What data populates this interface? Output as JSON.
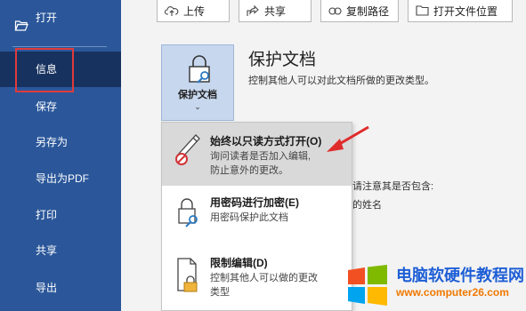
{
  "sidebar": {
    "items": [
      {
        "label": "打开"
      },
      {
        "label": "信息"
      },
      {
        "label": "保存"
      },
      {
        "label": "另存为"
      },
      {
        "label": "导出为PDF"
      },
      {
        "label": "打印"
      },
      {
        "label": "共享"
      },
      {
        "label": "导出"
      }
    ]
  },
  "toolbar": {
    "upload": "上传",
    "share": "共享",
    "copy_path": "复制路径",
    "open_location": "打开文件位置"
  },
  "protect": {
    "tile_label": "保护文档",
    "chevron": "⌄",
    "title": "保护文档",
    "description": "控制其他人可以对此文档所做的更改类型。"
  },
  "background": {
    "partial_line1": "请注意其是否包含:",
    "partial_line2": "的姓名"
  },
  "menu": {
    "items": [
      {
        "title": "始终以只读方式打开(O)",
        "desc_line1": "询问读者是否加入编辑,",
        "desc_line2": "防止意外的更改。"
      },
      {
        "title": "用密码进行加密(E)",
        "desc_line1": "用密码保护此文档",
        "desc_line2": ""
      },
      {
        "title": "限制编辑(D)",
        "desc_line1": "控制其他人可以做的更改",
        "desc_line2": "类型"
      }
    ]
  },
  "watermark": {
    "text": "电脑软硬件教程网",
    "url": "www.computer26.com"
  },
  "colors": {
    "sidebar": "#2b579a",
    "sidebar_active": "#17325f",
    "highlight_red": "#e03b3b",
    "menu_hover": "#d9d9d9",
    "tile_bg": "#c7d7ee"
  }
}
